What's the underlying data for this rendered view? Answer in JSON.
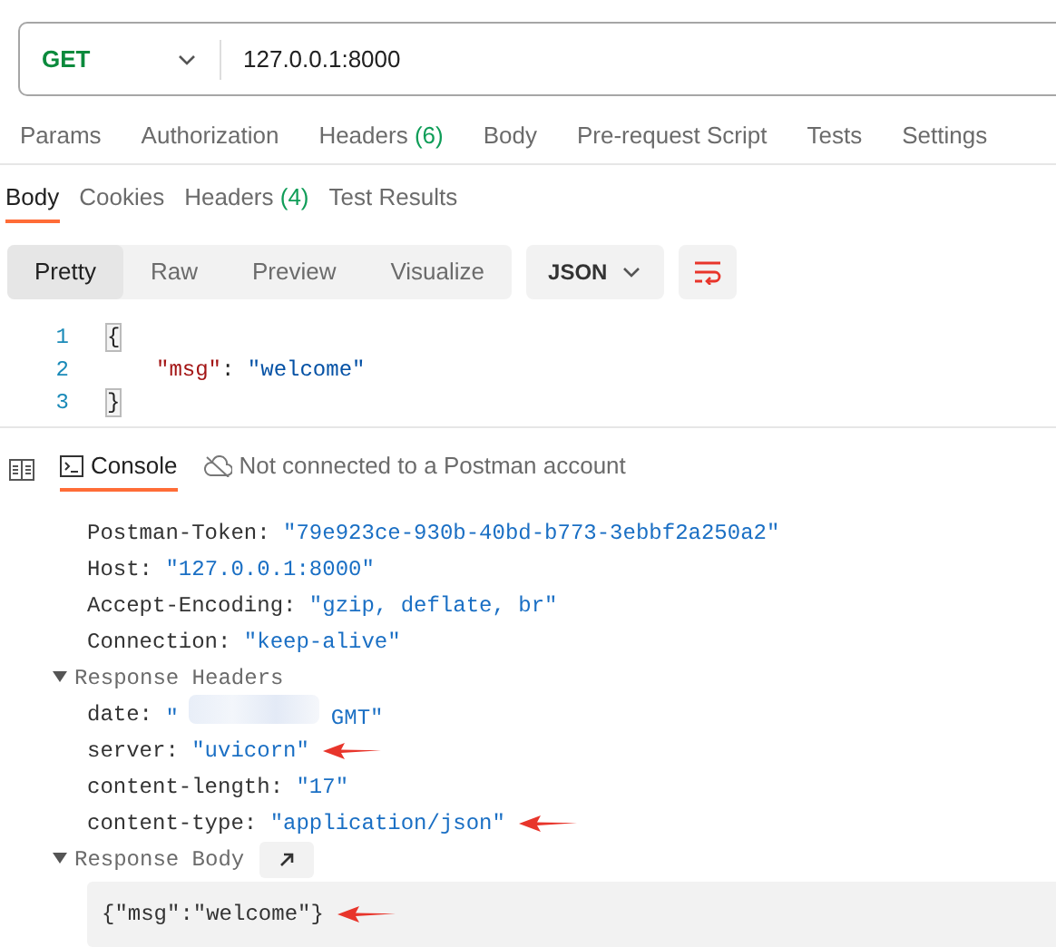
{
  "request": {
    "method": "GET",
    "url": "127.0.0.1:8000"
  },
  "request_tabs": [
    {
      "label": "Params",
      "selected": false
    },
    {
      "label": "Authorization",
      "selected": false
    },
    {
      "label": "Headers",
      "count": "(6)",
      "selected": false
    },
    {
      "label": "Body",
      "selected": false
    },
    {
      "label": "Pre-request Script",
      "selected": false
    },
    {
      "label": "Tests",
      "selected": false
    },
    {
      "label": "Settings",
      "selected": false
    }
  ],
  "response_tabs": [
    {
      "label": "Body",
      "selected": true
    },
    {
      "label": "Cookies",
      "selected": false
    },
    {
      "label": "Headers",
      "count": "(4)",
      "selected": false
    },
    {
      "label": "Test Results",
      "selected": false
    }
  ],
  "view_modes": [
    {
      "label": "Pretty",
      "selected": true
    },
    {
      "label": "Raw",
      "selected": false
    },
    {
      "label": "Preview",
      "selected": false
    },
    {
      "label": "Visualize",
      "selected": false
    }
  ],
  "format": "JSON",
  "code_lines": [
    {
      "number": "1",
      "kind": "bracket",
      "tokens": [
        {
          "kind": "punct",
          "text": "{"
        }
      ]
    },
    {
      "number": "2",
      "kind": "member",
      "tokens": [
        {
          "kind": "key",
          "text": "\"msg\""
        },
        {
          "kind": "punct",
          "text": ": "
        },
        {
          "kind": "string",
          "text": "\"welcome\""
        }
      ]
    },
    {
      "number": "3",
      "kind": "bracket",
      "tokens": [
        {
          "kind": "punct",
          "text": "}"
        }
      ]
    }
  ],
  "console_tabs": [
    {
      "label": "Console",
      "kind": "console",
      "selected": true
    },
    {
      "label": "Not connected to a Postman account",
      "kind": "account",
      "selected": false
    }
  ],
  "console_entries": [
    {
      "kind": "header",
      "key": "Postman-Token:",
      "value": "\"79e923ce-930b-40bd-b773-3ebbf2a250a2\"",
      "annotated": false
    },
    {
      "kind": "header",
      "key": "Host:",
      "value": "\"127.0.0.1:8000\"",
      "annotated": false
    },
    {
      "kind": "header",
      "key": "Accept-Encoding:",
      "value": "\"gzip, deflate, br\"",
      "annotated": false
    },
    {
      "kind": "header",
      "key": "Connection:",
      "value": "\"keep-alive\"",
      "annotated": false
    },
    {
      "kind": "section",
      "label": "Response Headers",
      "expanded": true,
      "children": [
        {
          "kind": "header",
          "key": "date:",
          "value": "\"",
          "value_end": "GMT\"",
          "redacted": true,
          "annotated": false
        },
        {
          "kind": "header",
          "key": "server:",
          "value": "\"uvicorn\"",
          "annotated": true
        },
        {
          "kind": "header",
          "key": "content-length:",
          "value": "\"17\"",
          "annotated": false
        },
        {
          "kind": "header",
          "key": "content-type:",
          "value": "\"application/json\"",
          "annotated": true
        }
      ]
    },
    {
      "kind": "section",
      "label": "Response Body",
      "expanded": true,
      "open_button": true,
      "children": [
        {
          "kind": "body",
          "text": "{\"msg\":\"welcome\"}",
          "annotated": true
        }
      ]
    }
  ]
}
